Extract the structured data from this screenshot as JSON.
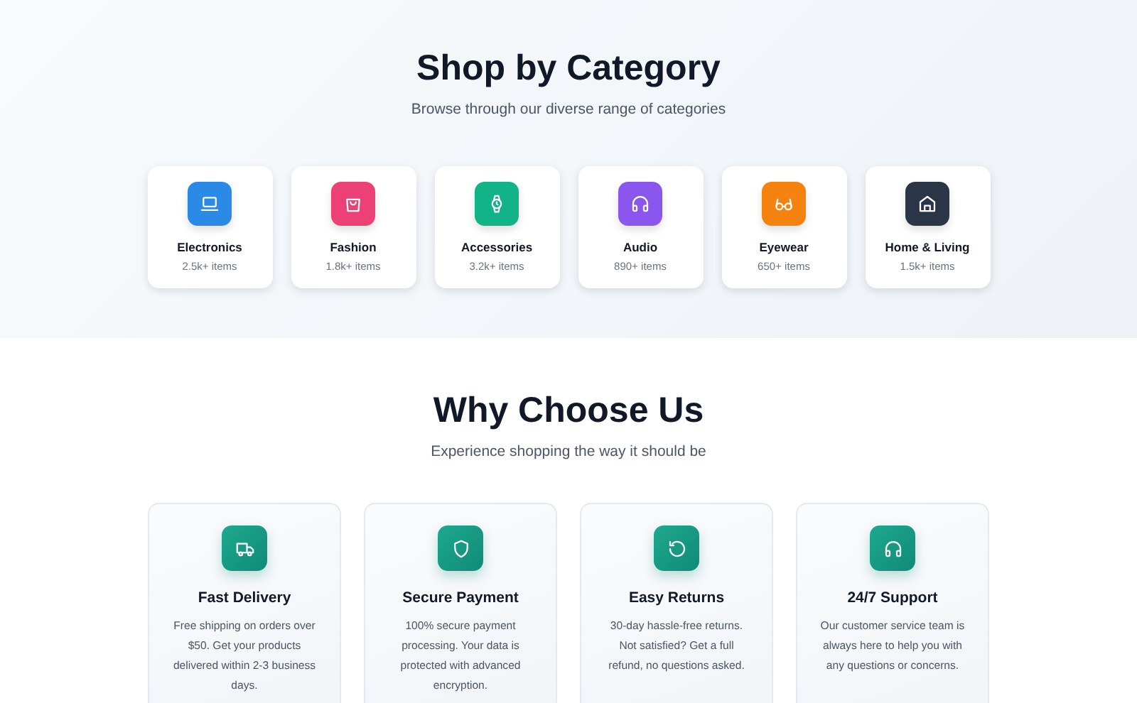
{
  "categories_section": {
    "title": "Shop by Category",
    "subtitle": "Browse through our diverse range of categories",
    "categories": [
      {
        "kind": "laptop",
        "color": "#2b8ae6",
        "name": "Electronics",
        "count": "2.5k+ items"
      },
      {
        "kind": "bag",
        "color": "#ec4176",
        "name": "Fashion",
        "count": "1.8k+ items"
      },
      {
        "kind": "watch",
        "color": "#13b388",
        "name": "Accessories",
        "count": "3.2k+ items"
      },
      {
        "kind": "headphones",
        "color": "#8a56ee",
        "name": "Audio",
        "count": "890+ items"
      },
      {
        "kind": "glasses",
        "color": "#f5820f",
        "name": "Eyewear",
        "count": "650+ items"
      },
      {
        "kind": "home",
        "color": "#2a3547",
        "name": "Home & Living",
        "count": "1.5k+ items"
      }
    ]
  },
  "features_section": {
    "title": "Why Choose Us",
    "subtitle": "Experience shopping the way it should be",
    "features": [
      {
        "kind": "truck",
        "title": "Fast Delivery",
        "text": "Free shipping on orders over $50. Get your products delivered within 2-3 business days."
      },
      {
        "kind": "shield",
        "title": "Secure Payment",
        "text": "100% secure payment processing. Your data is protected with advanced encryption."
      },
      {
        "kind": "rotate",
        "title": "Easy Returns",
        "text": "30-day hassle-free returns. Not satisfied? Get a full refund, no questions asked."
      },
      {
        "kind": "headphones",
        "title": "24/7 Support",
        "text": "Our customer service team is always here to help you with any questions or concerns."
      }
    ]
  }
}
